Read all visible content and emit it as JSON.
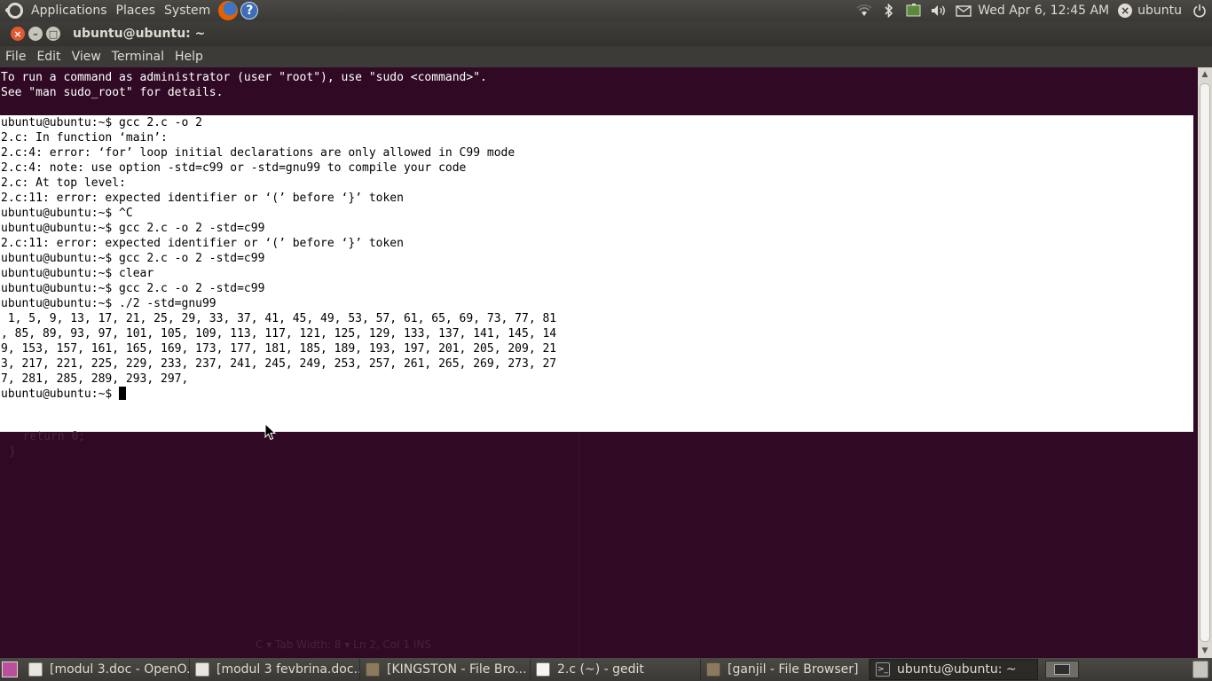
{
  "top_panel": {
    "menus": [
      "Applications",
      "Places",
      "System"
    ],
    "clock": "Wed Apr  6, 12:45 AM",
    "user": "ubuntu"
  },
  "window": {
    "title": "ubuntu@ubuntu: ~",
    "menus": [
      "File",
      "Edit",
      "View",
      "Terminal",
      "Help"
    ]
  },
  "terminal": {
    "header_lines": [
      "To run a command as administrator (user \"root\"), use \"sudo <command>\".",
      "See \"man sudo_root\" for details."
    ],
    "selected_lines": [
      "ubuntu@ubuntu:~$ gcc 2.c -o 2",
      "2.c: In function ‘main’:",
      "2.c:4: error: ‘for’ loop initial declarations are only allowed in C99 mode",
      "2.c:4: note: use option -std=c99 or -std=gnu99 to compile your code",
      "2.c: At top level:",
      "2.c:11: error: expected identifier or ‘(’ before ‘}’ token",
      "ubuntu@ubuntu:~$ ^C",
      "ubuntu@ubuntu:~$ gcc 2.c -o 2 -std=c99",
      "2.c:11: error: expected identifier or ‘(’ before ‘}’ token",
      "ubuntu@ubuntu:~$ gcc 2.c -o 2 -std=c99",
      "ubuntu@ubuntu:~$ clear",
      "ubuntu@ubuntu:~$ gcc 2.c -o 2 -std=c99",
      "ubuntu@ubuntu:~$ ./2 -std=gnu99",
      " 1, 5, 9, 13, 17, 21, 25, 29, 33, 37, 41, 45, 49, 53, 57, 61, 65, 69, 73, 77, 81",
      ", 85, 89, 93, 97, 101, 105, 109, 113, 117, 121, 125, 129, 133, 137, 141, 145, 14",
      "9, 153, 157, 161, 165, 169, 173, 177, 181, 185, 189, 193, 197, 201, 205, 209, 21",
      "3, 217, 221, 225, 229, 233, 237, 241, 245, 249, 253, 257, 261, 265, 269, 273, 27",
      "7, 281, 285, 289, 293, 297,"
    ],
    "prompt": "ubuntu@ubuntu:~$ ",
    "background_color": "#300a24",
    "selection_color": "#ffffff"
  },
  "taskbar": {
    "tasks": [
      {
        "label": "[modul 3.doc - OpenO...",
        "icon": "document-icon"
      },
      {
        "label": "[modul 3 fevbrina.doc...",
        "icon": "document-icon"
      },
      {
        "label": "[KINGSTON - File Bro...",
        "icon": "folder-icon"
      },
      {
        "label": "2.c (~) - gedit",
        "icon": "text-editor-icon"
      },
      {
        "label": "[ganjil - File Browser]",
        "icon": "folder-icon"
      },
      {
        "label": "ubuntu@ubuntu: ~",
        "icon": "terminal-icon"
      }
    ]
  }
}
